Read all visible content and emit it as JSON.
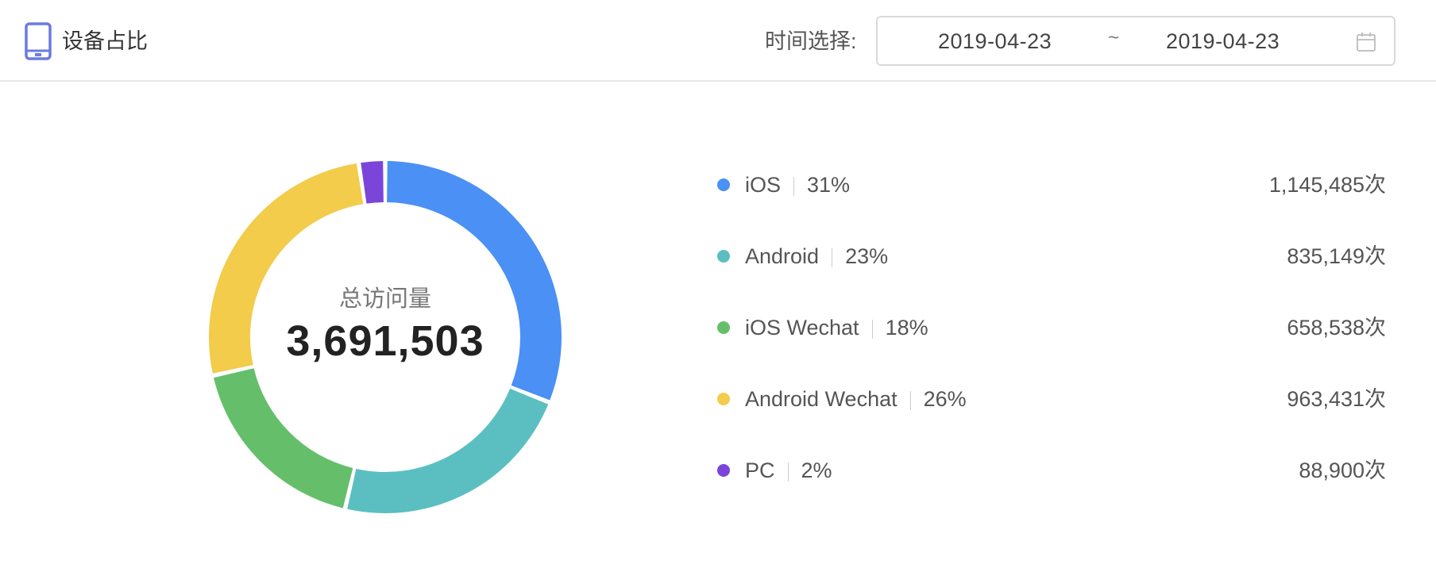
{
  "header": {
    "title": "设备占比",
    "date_label": "时间选择:",
    "date_start": "2019-04-23",
    "date_separator": "~",
    "date_end": "2019-04-23",
    "icon": "device-icon",
    "calendar_icon": "calendar-icon",
    "accent_color": "#6c7ae0"
  },
  "center": {
    "label": "总访问量",
    "value": "3,691,503"
  },
  "chart_data": {
    "type": "pie",
    "title": "",
    "series": [
      {
        "name": "iOS",
        "percent": "31%",
        "value": 1145485,
        "value_label": "1,145,485次",
        "color": "#4a90f5"
      },
      {
        "name": "Android",
        "percent": "23%",
        "value": 835149,
        "value_label": "835,149次",
        "color": "#5bbfc1"
      },
      {
        "name": "iOS Wechat",
        "percent": "18%",
        "value": 658538,
        "value_label": "658,538次",
        "color": "#65bf6a"
      },
      {
        "name": "Android Wechat",
        "percent": "26%",
        "value": 963431,
        "value_label": "963,431次",
        "color": "#f2cc4a"
      },
      {
        "name": "PC",
        "percent": "2%",
        "value": 88900,
        "value_label": "88,900次",
        "color": "#7b45d9"
      }
    ]
  }
}
